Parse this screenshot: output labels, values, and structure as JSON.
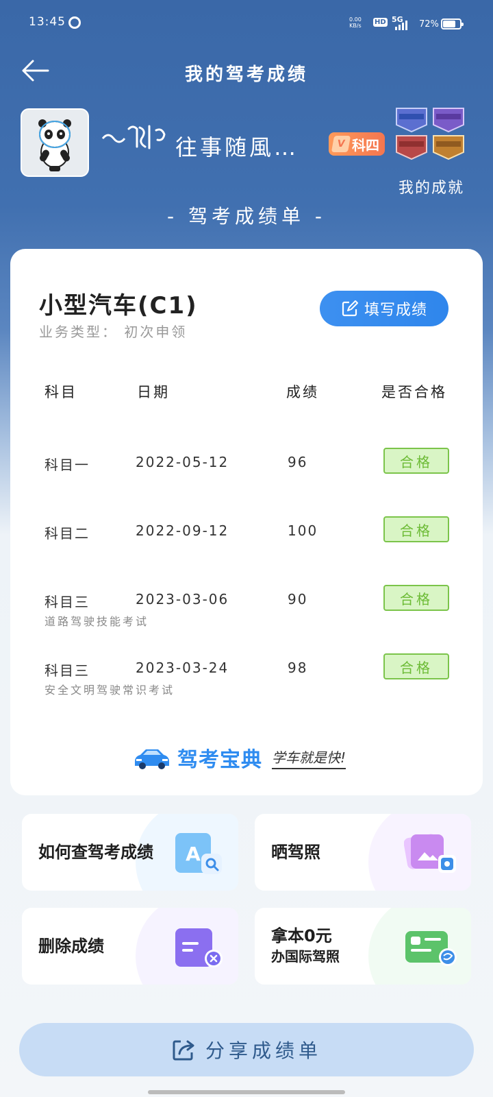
{
  "status_bar": {
    "time": "13:45",
    "net_speed": "0.00",
    "net_unit": "KB/s",
    "hd": "HD",
    "signal": "5G",
    "battery": "72%"
  },
  "header": {
    "title": "我的驾考成绩"
  },
  "profile": {
    "username": "往事随風…",
    "level_badge": "科四",
    "level_prefix": "V",
    "achievements_label": "我的成就"
  },
  "section_title": "- 驾考成绩单 -",
  "card": {
    "car_type": "小型汽车(C1)",
    "business_type": "业务类型： 初次申领",
    "fill_button": "填写成绩",
    "table": {
      "headers": [
        "科目",
        "日期",
        "成绩",
        "是否合格"
      ],
      "rows": [
        {
          "subject": "科目一",
          "date": "2022-05-12",
          "score": "96",
          "result": "合格",
          "note": ""
        },
        {
          "subject": "科目二",
          "date": "2022-09-12",
          "score": "100",
          "result": "合格",
          "note": ""
        },
        {
          "subject": "科目三",
          "date": "2023-03-06",
          "score": "90",
          "result": "合格",
          "note": "道路驾驶技能考试"
        },
        {
          "subject": "科目三",
          "date": "2023-03-24",
          "score": "98",
          "result": "合格",
          "note": "安全文明驾驶常识考试"
        }
      ]
    },
    "brand": {
      "name": "驾考宝典",
      "slogan": "学车就是快!"
    }
  },
  "tiles": [
    {
      "label": "如何查驾考成绩",
      "icon": "document-search-icon"
    },
    {
      "label": "晒驾照",
      "icon": "photo-share-icon"
    },
    {
      "label": "删除成绩",
      "icon": "delete-record-icon"
    },
    {
      "label": "拿本0元",
      "label2": "办国际驾照",
      "icon": "international-license-icon"
    }
  ],
  "share_button": "分享成绩单",
  "colors": {
    "header_bg": "#3a68a8",
    "accent": "#2f86ec",
    "pass_green": "#6cbb35",
    "pass_bg": "#d9f5c5"
  }
}
